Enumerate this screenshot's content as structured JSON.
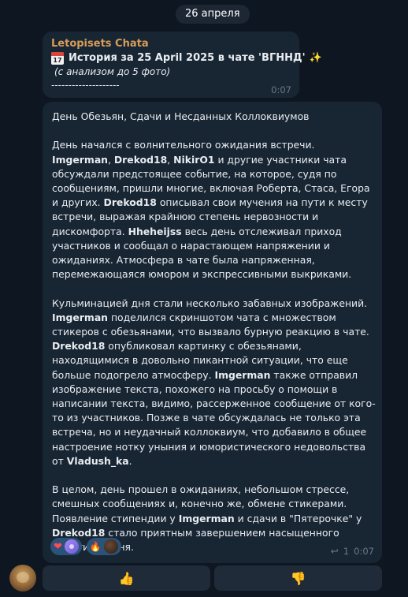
{
  "date_separator": "26 апреля",
  "message1": {
    "sender": "Letopisets Chata",
    "title": "История за 25 April 2025 в чате 'ВГННД'",
    "subtitle": "(с анализом до 5 фото)",
    "dashes": "--------------------",
    "time": "0:07",
    "icons": [
      "calendar-icon",
      "sparkles-icon"
    ]
  },
  "message2": {
    "heading": "День Обезьян, Сдачи и Несданных Коллоквиумов",
    "p1": [
      {
        "t": "День начался с волнительного ожидания встречи. ",
        "b": false
      },
      {
        "t": "Imgerman",
        "b": true
      },
      {
        "t": ", ",
        "b": false
      },
      {
        "t": "Drekod18",
        "b": true
      },
      {
        "t": ", ",
        "b": false
      },
      {
        "t": "NikirO1",
        "b": true
      },
      {
        "t": " и другие участники чата обсуждали предстоящее событие, на которое, судя по сообщениям, пришли многие, включая Роберта, Стаса, Егора и других. ",
        "b": false
      },
      {
        "t": "Drekod18",
        "b": true
      },
      {
        "t": " описывал свои мучения на пути к месту встречи, выражая крайнюю степень нервозности и дискомфорта. ",
        "b": false
      },
      {
        "t": "Hheheijss",
        "b": true
      },
      {
        "t": " весь день отслеживал приход участников и сообщал о нарастающем напряжении и ожиданиях. Атмосфера в чате была напряженная, перемежающаяся юмором и экспрессивными выкриками.",
        "b": false
      }
    ],
    "p2": [
      {
        "t": "Кульминацией дня стали несколько забавных изображений. ",
        "b": false
      },
      {
        "t": "Imgerman",
        "b": true
      },
      {
        "t": " поделился скриншотом чата с множеством стикеров с обезьянами, что вызвало бурную реакцию в чате. ",
        "b": false
      },
      {
        "t": "Drekod18",
        "b": true
      },
      {
        "t": " опубликовал картинку с обезьянами, находящимися в довольно пикантной ситуации, что еще больше подогрело атмосферу. ",
        "b": false
      },
      {
        "t": "Imgerman",
        "b": true
      },
      {
        "t": " также отправил изображение текста, похожего на просьбу о помощи в написании текста, видимо, рассерженное сообщение от кого-то из участников. Позже в чате обсуждалась не только эта встреча, но и неудачный коллоквиум, что добавило в общее настроение нотку уныния и юмористического недовольства от ",
        "b": false
      },
      {
        "t": "Vladush_ka",
        "b": true
      },
      {
        "t": ".",
        "b": false
      }
    ],
    "p3": [
      {
        "t": "В целом, день прошел в ожиданиях, небольшом стрессе, смешных сообщениях и, конечно же, обмене стикерами. Появление стипендии у ",
        "b": false
      },
      {
        "t": "Imgerman",
        "b": true
      },
      {
        "t": " и сдачи в \"Пятерочке\" у ",
        "b": false
      },
      {
        "t": "Drekod18",
        "b": true
      },
      {
        "t": " стало приятным завершением насыщенного событиями дня.",
        "b": false
      }
    ],
    "reactions": [
      {
        "emoji_icon": "heart-icon",
        "reactor": "purple-user-avatar"
      },
      {
        "emoji_icon": "fire-icon",
        "reactor": "dark-user-avatar"
      }
    ],
    "replies_count": "1",
    "time": "0:07"
  },
  "vote_buttons": {
    "up_icon": "thumbs-up-icon",
    "down_icon": "thumbs-down-icon",
    "up_glyph": "👍",
    "down_glyph": "👎"
  },
  "colors": {
    "background": "#0e1621",
    "bubble": "#182533",
    "sender_name": "#d89d58",
    "reaction_pill": "#2b5278",
    "meta_text": "#6c7883"
  }
}
